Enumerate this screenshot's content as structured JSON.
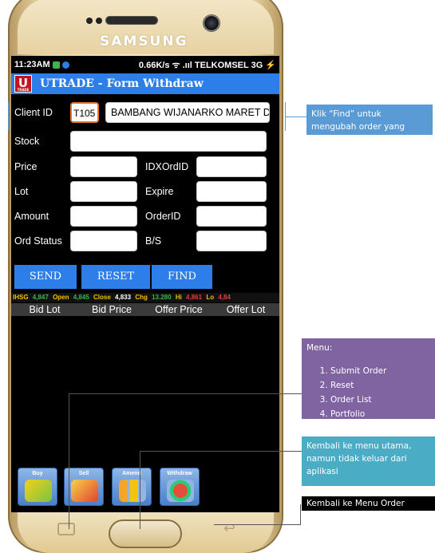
{
  "device": {
    "brand": "SAMSUNG"
  },
  "status_bar": {
    "time": "11:23AM",
    "right": "0.66K/s ᯤ .ııl TELKOMSEL 3G ⚡"
  },
  "app": {
    "logo_letter": "U",
    "logo_caption": "TRADE",
    "title": "UTRADE  -  Form Withdraw"
  },
  "form": {
    "client_id_label": "Client ID",
    "client_id_value": "T105",
    "client_name_value": "BAMBANG WIJANARKO MARET D",
    "stock_label": "Stock",
    "price_label": "Price",
    "idx_ord_id_label": "IDXOrdID",
    "lot_label": "Lot",
    "expire_label": "Expire",
    "amount_label": "Amount",
    "order_id_label": "OrderID",
    "ord_status_label": "Ord Status",
    "bs_label": "B/S"
  },
  "buttons": {
    "send": "SEND",
    "reset": "RESET",
    "find": "FIND"
  },
  "ticker": {
    "ihsg_label": "IHSG",
    "ihsg_value": "4,847",
    "open_label": "Open",
    "open_value": "4,845",
    "close_label": "Close",
    "close_value": "4,833",
    "chg_label": "Chg",
    "chg_value": "13.280",
    "hi_label": "Hi",
    "hi_value": "4,861",
    "lo_label": "Lo",
    "lo_value": "4,84"
  },
  "table": {
    "columns": [
      "Bid Lot",
      "Bid Price",
      "Offer Price",
      "Offer Lot"
    ]
  },
  "menu": {
    "buy": "Buy",
    "sell": "Sell",
    "amend": "Amend",
    "withdraw": "Withdraw"
  },
  "annotations": {
    "find_note": "Klik “Find” untuk mengubah order yang",
    "menu_title": "Menu:",
    "menu_items": [
      "Submit Order",
      "Reset",
      "Order List",
      "Portfolio"
    ],
    "home_note": "Kembali ke menu utama, namun tidak keluar dari aplikasi",
    "back_note": "Kembali ke Menu Order"
  },
  "colors": {
    "app_header": "#2d7ee8",
    "button": "#2d7ee8",
    "note_find": "#5b9bd5",
    "note_menu": "#8064a2",
    "note_home": "#4bacc6",
    "note_back": "#000000"
  }
}
